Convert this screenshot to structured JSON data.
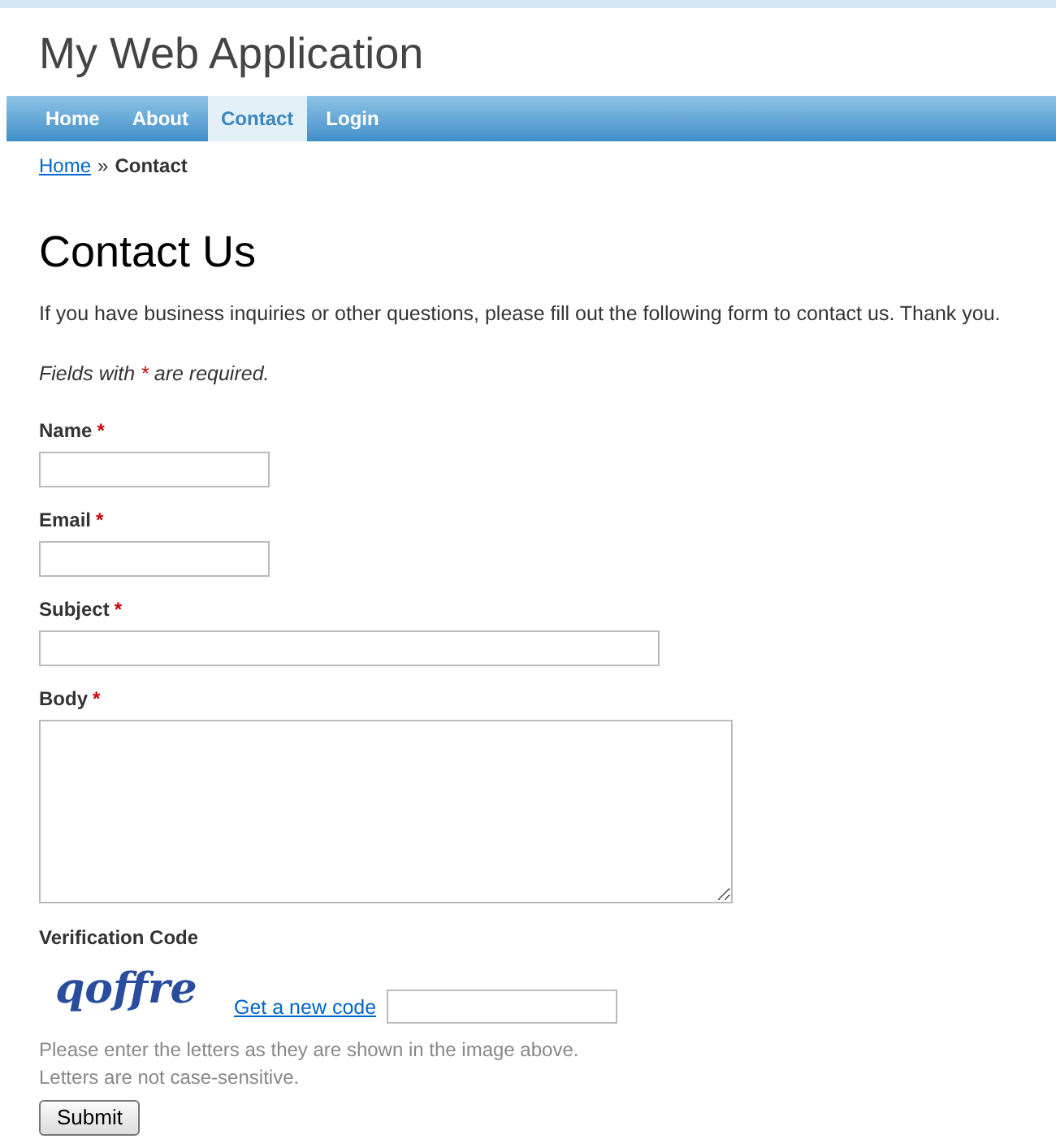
{
  "header": {
    "title": "My Web Application"
  },
  "nav": [
    {
      "label": "Home",
      "selected": false
    },
    {
      "label": "About",
      "selected": false
    },
    {
      "label": "Contact",
      "selected": true
    },
    {
      "label": "Login",
      "selected": false
    }
  ],
  "breadcrumb": {
    "link": "Home",
    "separator": "»",
    "current": "Contact"
  },
  "heading": "Contact Us",
  "intro": "If you have business inquiries or other questions, please fill out the following form to contact us. Thank you.",
  "required_note": {
    "before": "Fields with",
    "after": "are required."
  },
  "required_mark": "*",
  "fields": [
    {
      "label": "Name",
      "required": true,
      "kind": "short"
    },
    {
      "label": "Email",
      "required": true,
      "kind": "short"
    },
    {
      "label": "Subject",
      "required": true,
      "kind": "long"
    },
    {
      "label": "Body",
      "required": true,
      "kind": "area"
    }
  ],
  "verification": {
    "label": "Verification Code",
    "captcha": "qoffre",
    "new_code_link": "Get a new code",
    "hint": [
      "Please enter the letters as they are shown in the image above.",
      "Letters are not case-sensitive."
    ]
  },
  "submit": "Submit"
}
